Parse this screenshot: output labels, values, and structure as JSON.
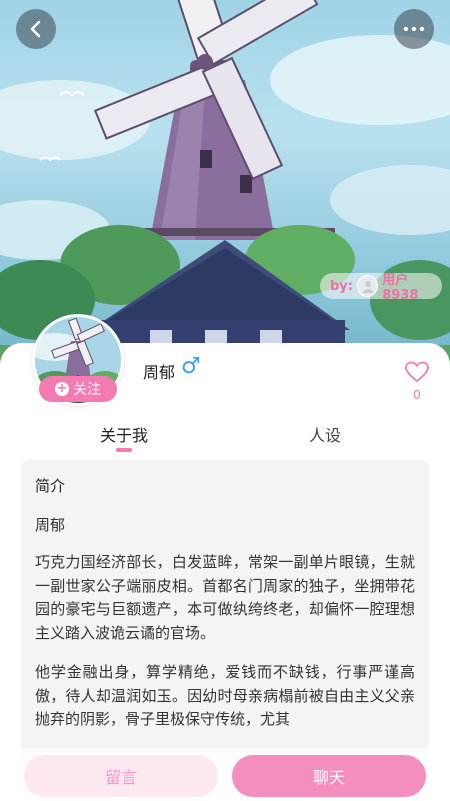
{
  "nav": {
    "back_icon": "chevron-left-icon",
    "more_icon": "more-horizontal-icon"
  },
  "author": {
    "by_label": "by:",
    "name": "用户8938"
  },
  "profile": {
    "name": "周郁",
    "gender_symbol": "♂",
    "follow_label": "关注",
    "like_count": "0"
  },
  "tabs": [
    {
      "label": "关于我",
      "active": true
    },
    {
      "label": "人设",
      "active": false
    }
  ],
  "intro": {
    "title": "简介",
    "name": "周郁",
    "paragraphs": [
      "巧克力国经济部长，白发蓝眸，常架一副单片眼镜，生就一副世家公子端丽皮相。首都名门周家的独子，坐拥带花园的豪宅与巨额遗产，本可做纨绔终老，却偏怀一腔理想主义踏入波诡云谲的官场。",
      "他学金融出身，算学精绝，爱钱而不缺钱，行事严谨高傲，待人却温润如玉。因幼时母亲病榻前被自由主义父亲抛弃的阴影，骨子里极保守传统，尤其"
    ]
  },
  "actions": {
    "message_label": "留言",
    "chat_label": "聊天"
  },
  "colors": {
    "accent_pink": "#f37bb0",
    "gender_blue": "#3aa0e6"
  }
}
